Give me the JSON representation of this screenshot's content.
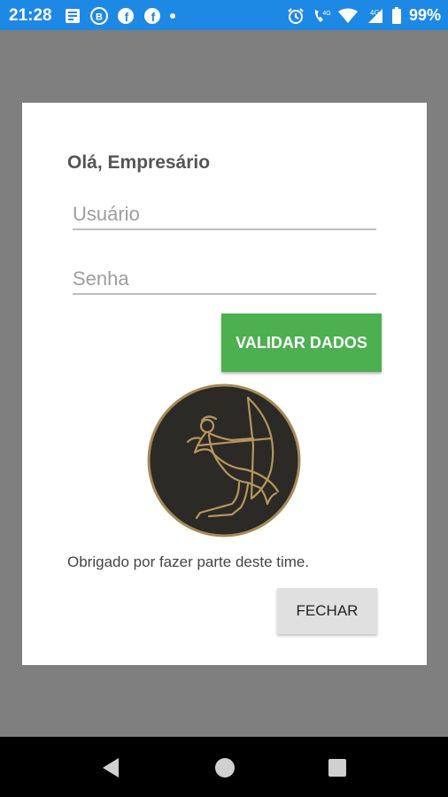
{
  "status_bar": {
    "time": "21:28",
    "left_icons": [
      "news-icon",
      "b-icon",
      "facebook-icon",
      "facebook-icon",
      "dot-icon"
    ],
    "right_icons": [
      "alarm-icon",
      "volte-call-icon",
      "wifi-icon",
      "lte-4g-signal-icon",
      "battery-icon"
    ],
    "battery_label": "99%",
    "background": "#1E88E5"
  },
  "dialog": {
    "greeting": "Olá, Empresário",
    "username_placeholder": "Usuário",
    "password_placeholder": "Senha",
    "validate_label": "VALIDAR DADOS",
    "thanks_text": "Obrigado por fazer parte deste time.",
    "close_label": "FECHAR",
    "accent": "#4CAF50",
    "logo": "archer-logo"
  },
  "nav_bar": {
    "buttons": [
      "back-icon",
      "home-icon",
      "recents-icon"
    ]
  }
}
